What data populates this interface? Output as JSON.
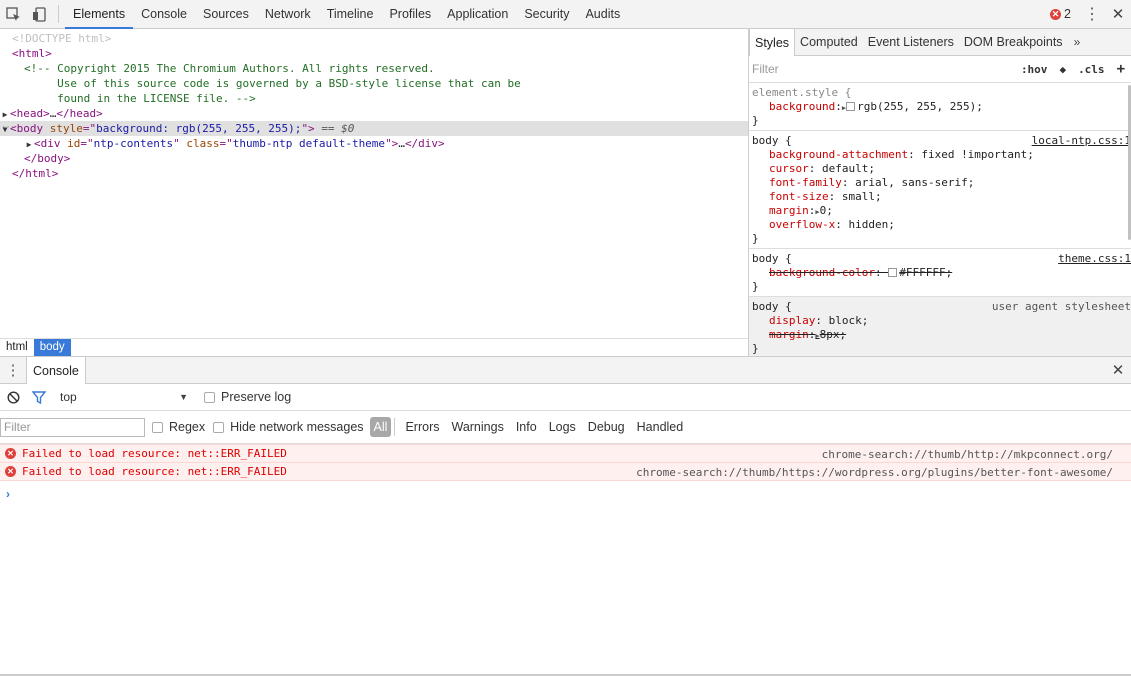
{
  "toolbar": {
    "tabs": [
      "Elements",
      "Console",
      "Sources",
      "Network",
      "Timeline",
      "Profiles",
      "Application",
      "Security",
      "Audits"
    ],
    "active_tab": "Elements",
    "error_count": "2"
  },
  "dom": {
    "doctype": "<!DOCTYPE html>",
    "html_open": "<html>",
    "comment": [
      "<!-- Copyright 2015 The Chromium Authors. All rights reserved.",
      "     Use of this source code is governed by a BSD-style license that can be",
      "     found in the LICENSE file. -->"
    ],
    "head_open": "<head>",
    "ellipsis": "…",
    "head_close": "</head>",
    "body_tag": "<body",
    "body_attr": "style",
    "body_attr_val": "background: rgb(255, 255, 255);",
    "selected_marker": "== $0",
    "div_open": "<div",
    "div_attr1": "id",
    "div_val1": "ntp-contents",
    "div_attr2": "class",
    "div_val2": "thumb-ntp default-theme",
    "div_close": "</div>",
    "body_close": "</body>",
    "html_close": "</html>"
  },
  "breadcrumbs": [
    "html",
    "body"
  ],
  "sidebar": {
    "tabs": [
      "Styles",
      "Computed",
      "Event Listeners",
      "DOM Breakpoints"
    ],
    "active_tab": "Styles",
    "filter_placeholder": "Filter",
    "hov": ":hov",
    "cls": ".cls",
    "add": "+",
    "rules": [
      {
        "selector": "element.style {",
        "source": "",
        "props": [
          {
            "name": "background",
            "value": "rgb(255, 255, 255);",
            "swatch": true,
            "expand": true,
            "struck": false
          }
        ]
      },
      {
        "selector": "body {",
        "source": "local-ntp.css:1",
        "props": [
          {
            "name": "background-attachment",
            "value": "fixed !important;"
          },
          {
            "name": "cursor",
            "value": "default;"
          },
          {
            "name": "font-family",
            "value": "arial, sans-serif;"
          },
          {
            "name": "font-size",
            "value": "small;"
          },
          {
            "name": "margin",
            "value": "0;",
            "expand": true
          },
          {
            "name": "overflow-x",
            "value": "hidden;"
          }
        ]
      },
      {
        "selector": "body {",
        "source": "theme.css:1",
        "props": [
          {
            "name": "background-color",
            "value": "#FFFFFF;",
            "swatch": true,
            "struck": true
          }
        ]
      },
      {
        "selector": "body {",
        "source": "user agent stylesheet",
        "ua": true,
        "props": [
          {
            "name": "display",
            "value": "block;"
          },
          {
            "name": "margin",
            "value": "8px;",
            "expand": true,
            "struck": true
          }
        ]
      }
    ],
    "close_brace": "}"
  },
  "drawer": {
    "tab": "Console",
    "context": "top",
    "preserve_log": "Preserve log",
    "filter_placeholder": "Filter",
    "regex": "Regex",
    "hide_network": "Hide network messages",
    "levels": [
      "All",
      "Errors",
      "Warnings",
      "Info",
      "Logs",
      "Debug",
      "Handled"
    ],
    "messages": [
      {
        "text": "Failed to load resource: net::ERR_FAILED",
        "source": "chrome-search://thumb/http://mkpconnect.org/"
      },
      {
        "text": "Failed to load resource: net::ERR_FAILED",
        "source": "chrome-search://thumb/https://wordpress.org/plugins/better-font-awesome/"
      }
    ],
    "prompt": "›"
  },
  "colors": {
    "accent": "#3879d9",
    "error": "#e0403a",
    "error_bg": "#fff0f0"
  }
}
